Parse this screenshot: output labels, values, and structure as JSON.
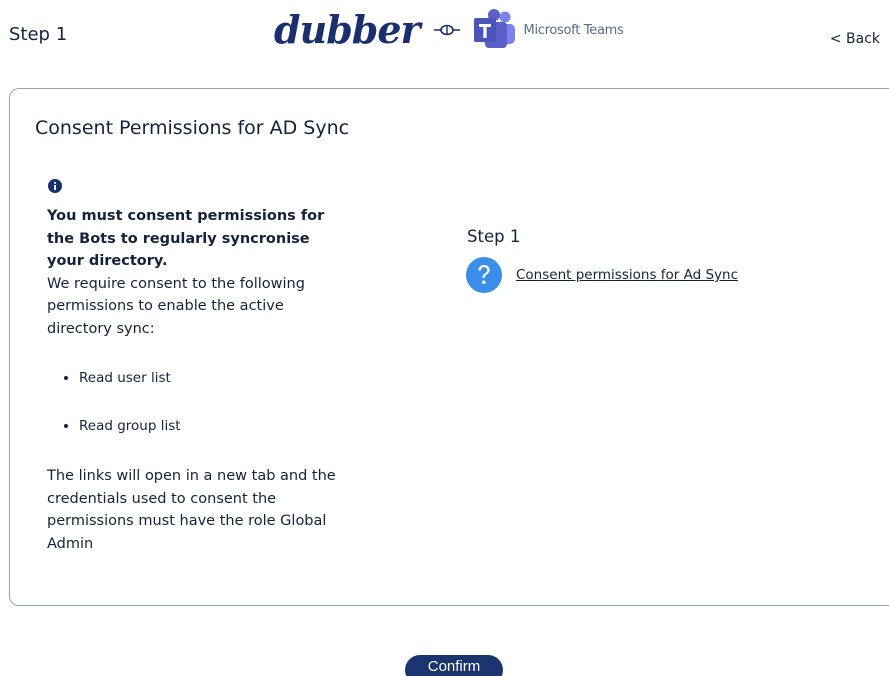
{
  "header": {
    "step_label": "Step 1",
    "brand_name": "dubber",
    "partner_name": "Microsoft Teams",
    "back_label": "< Back"
  },
  "card": {
    "title": "Consent Permissions for AD Sync",
    "info": {
      "heading": "You must consent permissions for the Bots to regularly syncronise your directory.",
      "body": "We require consent to the following permissions to enable the active directory sync:",
      "permissions": [
        "Read user list",
        "Read group list"
      ],
      "footnote": "The links will open in a new tab and the credentials used to consent the permissions must have the role Global Admin"
    },
    "step": {
      "heading": "Step 1",
      "link_label": "Consent permissions for Ad Sync"
    }
  },
  "actions": {
    "confirm_label": "Confirm"
  },
  "colors": {
    "brand_navy": "#1a2f6d",
    "button_navy": "#1a3470",
    "help_blue": "#3b8ee8",
    "teams_purple": "#5b5fc7"
  }
}
